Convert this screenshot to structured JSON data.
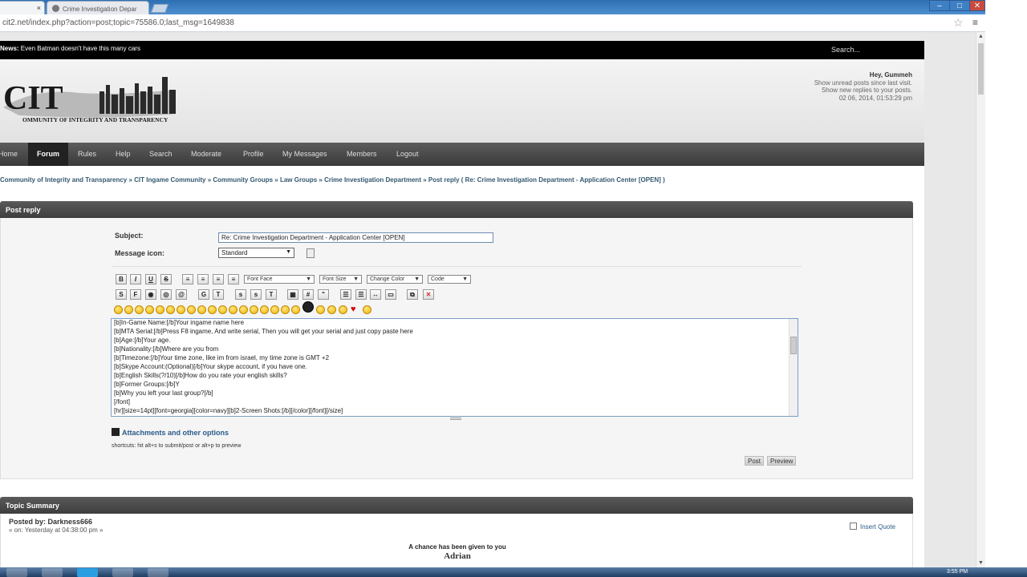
{
  "browser": {
    "tab1_close": "×",
    "tab2_title": "Crime Investigation Depar",
    "url": "cit2.net/index.php?action=post;topic=75586.0;last_msg=1649838",
    "min": "–",
    "max": "□",
    "close": "✕"
  },
  "newsbar": {
    "news_label": "News:",
    "news_text": " Even Batman doesn't have this many cars",
    "search_placeholder": "Search..."
  },
  "header": {
    "logo_text": "CIT",
    "logo_subtitle": "OMMUNITY OF INTEGRITY AND TRANSPARENCY",
    "greeting": "Hey, Gummeh",
    "unread": "Show unread posts since last visit.",
    "replies": "Show new replies to your posts.",
    "datetime": "02 06, 2014, 01:53:29 pm"
  },
  "nav": {
    "items": [
      "Home",
      "Forum",
      "Rules",
      "Help",
      "Search",
      "Moderate",
      "Profile",
      "My Messages",
      "Members",
      "Logout"
    ]
  },
  "breadcrumb": "Community of Integrity and Transparency » CIT Ingame Community » Community Groups » Law Groups » Crime Investigation Department » Post reply ( Re: Crime Investigation Department - Application Center [OPEN] )",
  "postreply": {
    "title": "Post reply",
    "subject_label": "Subject:",
    "subject_value": "Re: Crime Investigation Department - Application Center [OPEN]",
    "msgicon_label": "Message icon:",
    "msgicon_value": "Standard",
    "font_face": "Font Face",
    "font_size": "Font Size",
    "change_color": "Change Color",
    "code": "Code",
    "editor_lines": [
      "[b]In-Game Name:[/b]Your ingame name here",
      "[b]MTA Serial:[/b]Press F8 ingame, And write serial, Then you will get your serial and just copy paste here",
      "[b]Age:[/b]Your age.",
      "[b]Nationality:[/b]Where are you from",
      "[b]Timezone:[/b]Your time zone, like im from israel, my time zone is GMT +2",
      "[b]Skype Account:(Optional)[/b]Your skype account, if you have one.",
      "[b]English Skills(?/10)[/b]How do you rate your english skills?",
      "[b]Former Groups:[/b]Y",
      "[b]Why you left your last group?[/b]",
      "[/font]",
      "[hr][size=14pt][font=georgia][color=navy][b]2-Screen Shots:[/b][/color][/font][/size]"
    ],
    "attachments": "Attachments and other options",
    "shortcuts": "shortcuts: hit alt+s to submit/post or alt+p to preview",
    "post_btn": "Post",
    "preview_btn": "Preview"
  },
  "topic": {
    "title": "Topic Summary",
    "posted_by": "Posted by: Darkness666",
    "posted_on": "« on: Yesterday at 04:38:00 pm »",
    "insert_quote": "Insert Quote",
    "line1": "A chance has been given to you",
    "line2": "Adrian"
  },
  "taskbar": {
    "time": "3:55 PM"
  }
}
